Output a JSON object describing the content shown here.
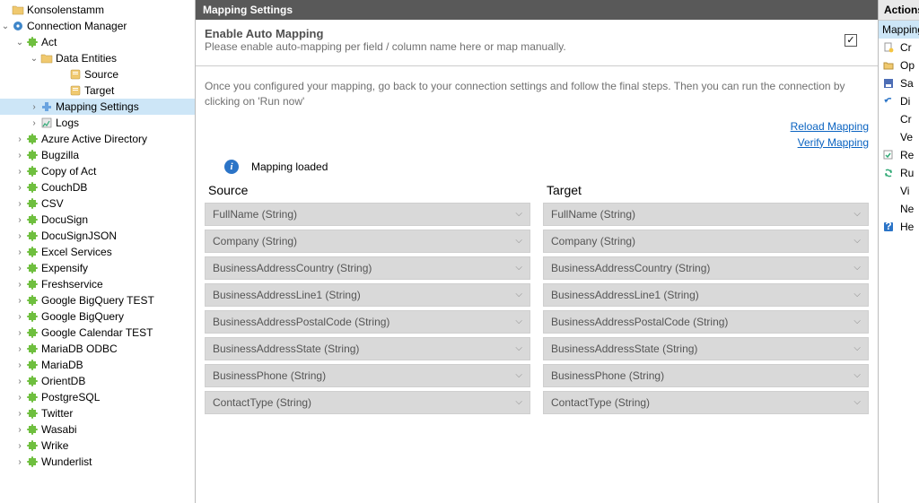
{
  "tree": {
    "root": "Konsolenstamm",
    "connMgr": "Connection Manager",
    "connections": [
      {
        "name": "Act",
        "expanded": true,
        "children": [
          {
            "name": "Data Entities",
            "icon": "folder",
            "expanded": true,
            "children": [
              {
                "name": "Source",
                "icon": "book"
              },
              {
                "name": "Target",
                "icon": "book"
              }
            ]
          },
          {
            "name": "Mapping Settings",
            "icon": "tool",
            "selected": true,
            "hasChildren": true
          },
          {
            "name": "Logs",
            "icon": "log",
            "hasChildren": true
          }
        ]
      },
      {
        "name": "Azure Active Directory"
      },
      {
        "name": "Bugzilla"
      },
      {
        "name": "Copy of Act"
      },
      {
        "name": "CouchDB"
      },
      {
        "name": "CSV"
      },
      {
        "name": "DocuSign"
      },
      {
        "name": "DocuSignJSON"
      },
      {
        "name": "Excel Services"
      },
      {
        "name": "Expensify"
      },
      {
        "name": "Freshservice"
      },
      {
        "name": "Google BigQuery TEST"
      },
      {
        "name": "Google BigQuery"
      },
      {
        "name": "Google Calendar TEST"
      },
      {
        "name": "MariaDB ODBC"
      },
      {
        "name": "MariaDB"
      },
      {
        "name": "OrientDB"
      },
      {
        "name": "PostgreSQL"
      },
      {
        "name": "Twitter"
      },
      {
        "name": "Wasabi"
      },
      {
        "name": "Wrike"
      },
      {
        "name": "Wunderlist"
      }
    ]
  },
  "panel": {
    "title": "Mapping Settings",
    "enable": {
      "heading": "Enable Auto Mapping",
      "desc": "Please enable auto-mapping per field / column name here or map manually.",
      "checked": true
    },
    "info": "Once you configured your mapping, go back to your connection settings and follow the final steps. Then you can run the connection by clicking on 'Run now'",
    "links": {
      "reload": "Reload Mapping",
      "verify": "Verify Mapping"
    },
    "loaded": "Mapping loaded",
    "sourceHeader": "Source",
    "targetHeader": "Target",
    "rows": [
      {
        "s": "FullName (String)",
        "t": "FullName (String)"
      },
      {
        "s": "Company (String)",
        "t": "Company (String)"
      },
      {
        "s": "BusinessAddressCountry (String)",
        "t": "BusinessAddressCountry (String)"
      },
      {
        "s": "BusinessAddressLine1 (String)",
        "t": "BusinessAddressLine1 (String)"
      },
      {
        "s": "BusinessAddressPostalCode (String)",
        "t": "BusinessAddressPostalCode (String)"
      },
      {
        "s": "BusinessAddressState (String)",
        "t": "BusinessAddressState (String)"
      },
      {
        "s": "BusinessPhone (String)",
        "t": "BusinessPhone (String)"
      },
      {
        "s": "ContactType (String)",
        "t": "ContactType (String)"
      }
    ]
  },
  "actions": {
    "title": "Actions",
    "selected": "Mapping",
    "items": [
      "Cr",
      "Op",
      "Sa",
      "Di",
      "Cr",
      "Ve",
      "Re",
      "Ru",
      "Vi",
      "Ne",
      "He"
    ]
  }
}
